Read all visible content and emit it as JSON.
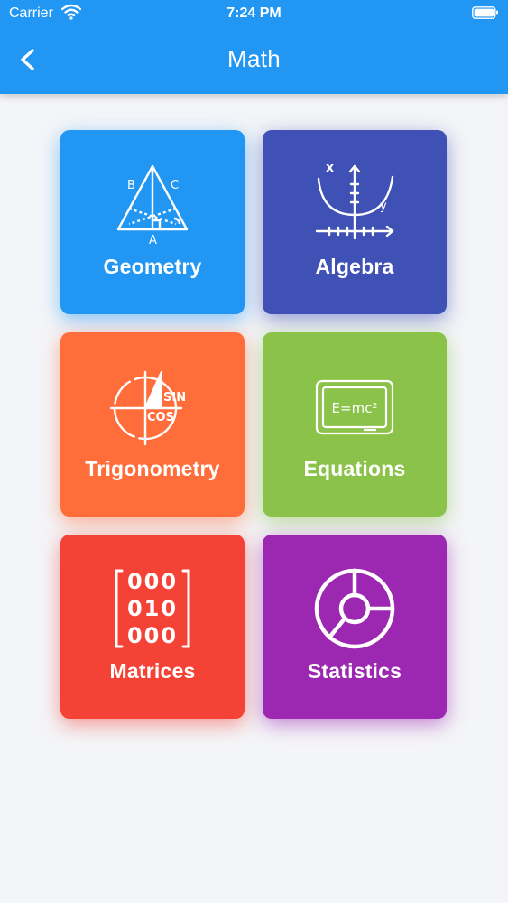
{
  "status_bar": {
    "carrier": "Carrier",
    "time": "7:24 PM"
  },
  "nav": {
    "title": "Math",
    "back_icon": "chevron-left-icon"
  },
  "tiles": [
    {
      "label": "Geometry",
      "color": "#2196f3",
      "icon": "triangle-icon",
      "icon_text": [
        "B",
        "C",
        "A"
      ]
    },
    {
      "label": "Algebra",
      "color": "#3f51b5",
      "icon": "parabola-graph-icon",
      "icon_text": [
        "x",
        "y"
      ]
    },
    {
      "label": "Trigonometry",
      "color": "#ff6d3a",
      "icon": "unit-circle-icon",
      "icon_text": [
        "SIN",
        "COS"
      ]
    },
    {
      "label": "Equations",
      "color": "#8bc34a",
      "icon": "chalkboard-icon",
      "icon_text": [
        "E=mc²"
      ]
    },
    {
      "label": "Matrices",
      "color": "#f44336",
      "icon": "matrix-icon",
      "icon_text": [
        "000",
        "010",
        "000"
      ]
    },
    {
      "label": "Statistics",
      "color": "#9c27b0",
      "icon": "pie-chart-icon",
      "icon_text": []
    }
  ]
}
